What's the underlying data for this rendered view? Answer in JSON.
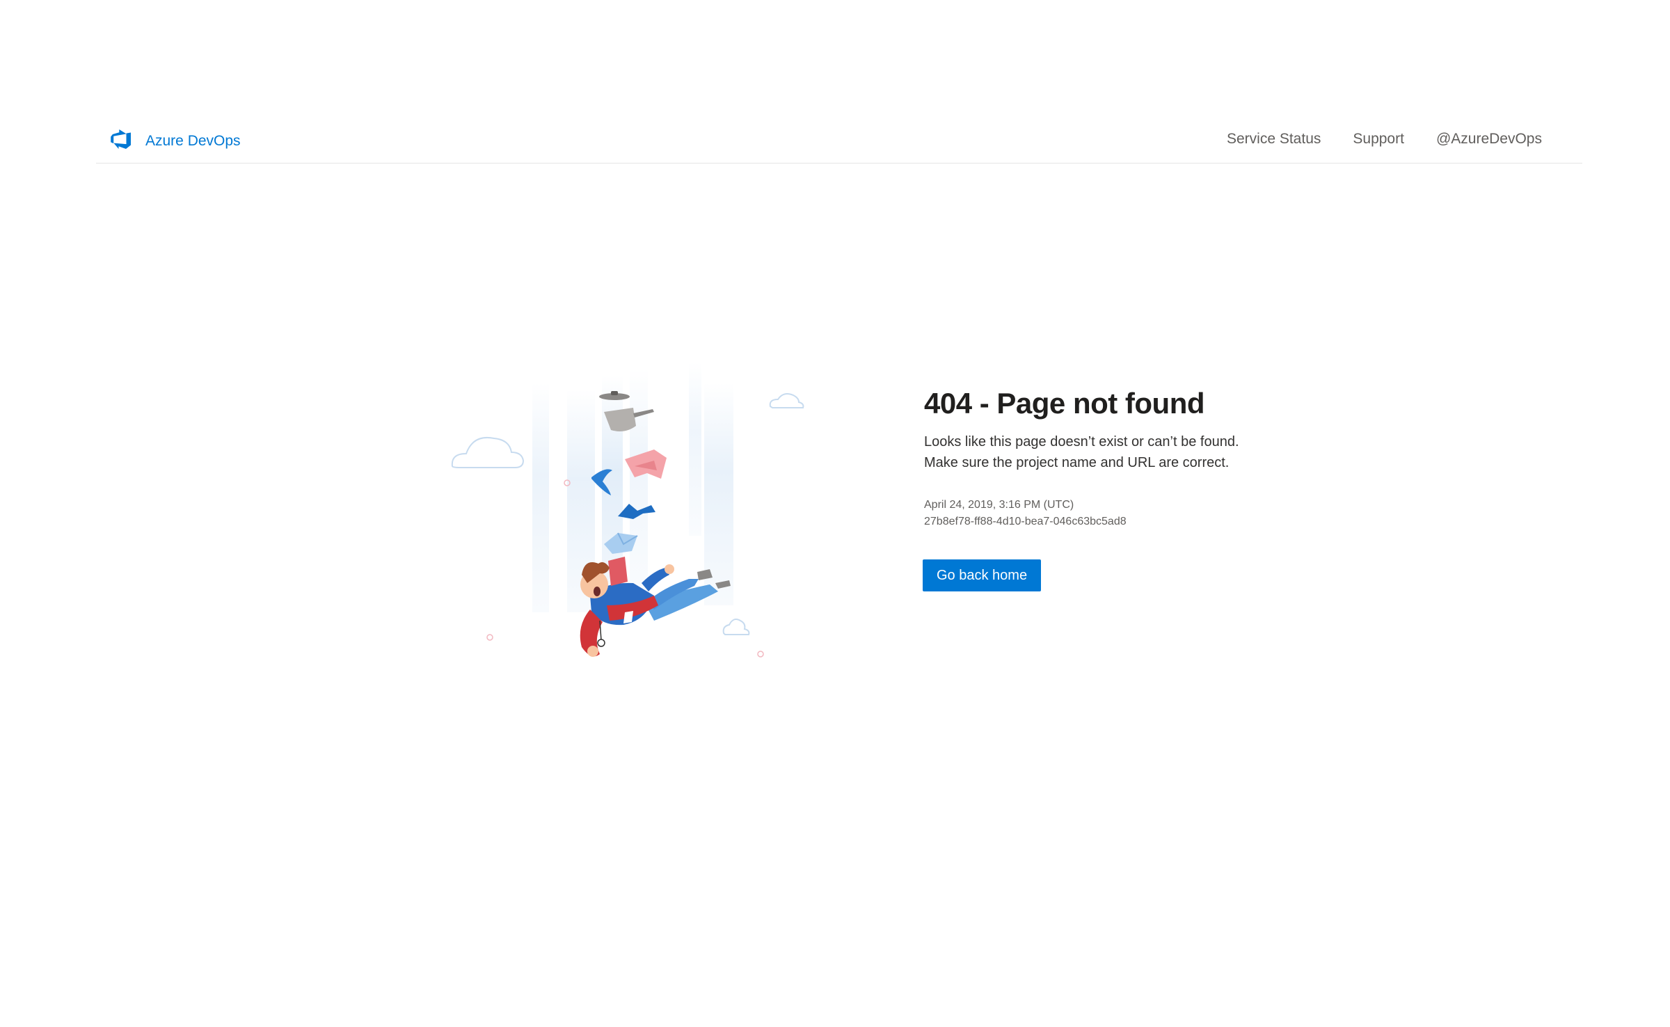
{
  "header": {
    "brand": {
      "label": "Azure DevOps",
      "icon": "azure-devops-logo-icon"
    },
    "nav": [
      {
        "label": "Service Status"
      },
      {
        "label": "Support"
      },
      {
        "label": "@AzureDevOps"
      }
    ]
  },
  "main": {
    "title": "404 - Page not found",
    "description": [
      "Looks like this page doesn’t exist or can’t be found.",
      "Make sure the project name and URL are correct."
    ],
    "timestamp": "April 24, 2019, 3:16 PM (UTC)",
    "activity_id": "27b8ef78-ff88-4d10-bea7-046c63bc5ad8",
    "button_label": "Go back home"
  },
  "colors": {
    "accent": "#0078d4",
    "title": "#201f1e",
    "text": "#323130",
    "muted": "#605e5c"
  }
}
